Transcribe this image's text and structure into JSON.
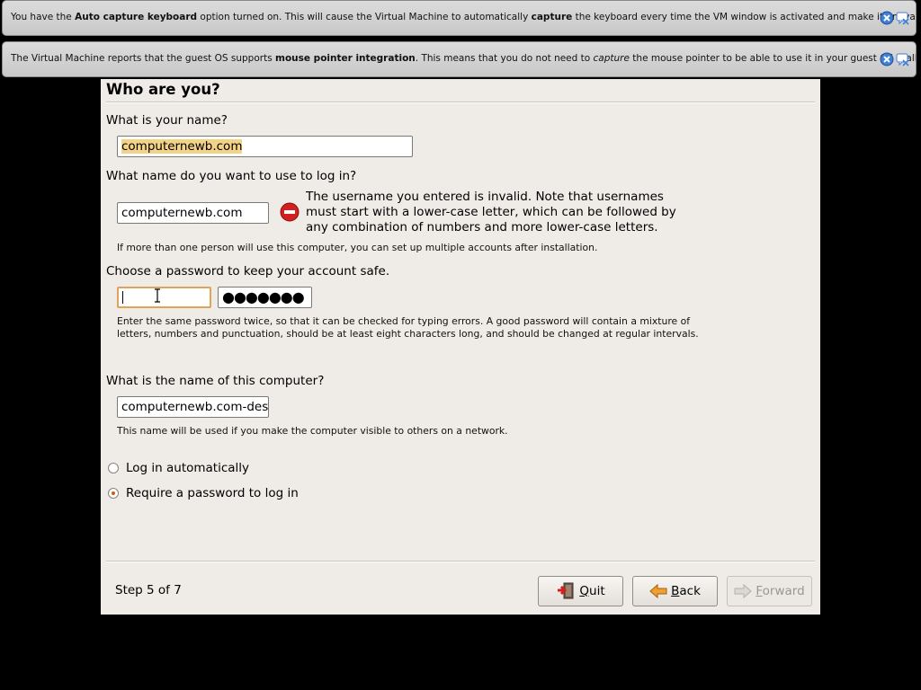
{
  "banners": {
    "keyboard": {
      "prefix": "You have the ",
      "bold1": "Auto capture keyboard",
      "mid": " option turned on. This will cause the Virtual Machine to automatically ",
      "bold2": "capture",
      "suffix": " the keyboard every time the VM window is activated and make it unavailable to"
    },
    "mouse": {
      "prefix": "The Virtual Machine reports that the guest OS supports ",
      "bold1": "mouse pointer integration",
      "mid": ". This means that you do not need to ",
      "italic": "capture",
      "suffix": " the mouse pointer to be able to use it in your guest OS -- all mouse"
    }
  },
  "page": {
    "title": "Who are you?",
    "name_label": "What is your name?",
    "name_value": "computernewb.com",
    "login_label": "What name do you want to use to log in?",
    "login_value": "computernewb.com",
    "login_error": "The username you entered is invalid. Note that usernames must start with a lower-case letter, which can be followed by any combination of numbers and more lower-case letters.",
    "multi_user_hint": "If more than one person will use this computer, you can set up multiple accounts after installation.",
    "password_label": "Choose a password to keep your account safe.",
    "password_value": "",
    "password_confirm_value": "●●●●●●●",
    "password_hint": "Enter the same password twice, so that it can be checked for typing errors. A good password will contain a mixture of letters, numbers and punctuation, should be at least eight characters long, and should be changed at regular intervals.",
    "computer_label": "What is the name of this computer?",
    "computer_value": "computernewb.com-desk",
    "computer_hint": "This name will be used if you make the computer visible to others on a network.",
    "radio_auto": "Log in automatically",
    "radio_password": "Require a password to log in",
    "selected_login_option": "Require a password to log in",
    "step": "Step 5 of 7"
  },
  "buttons": {
    "quit_label": "uit",
    "quit_mnemonic": "Q",
    "back_label": "ack",
    "back_mnemonic": "B",
    "forward_label": "orward",
    "forward_mnemonic": "F"
  },
  "icons": {
    "banner_close": "close-icon",
    "banner_hide": "hide-message-icon",
    "error": "error-no-entry-icon",
    "quit": "quit-door-icon",
    "back": "back-arrow-icon",
    "forward": "forward-arrow-icon"
  },
  "colors": {
    "error_red": "#d21f1f",
    "focus_orange": "#e0a35a",
    "selection": "#f3d388",
    "window_bg": "#efebe7"
  }
}
